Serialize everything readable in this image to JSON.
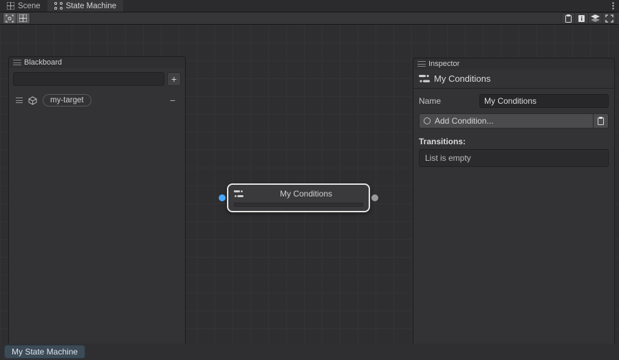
{
  "tabs": {
    "scene": "Scene",
    "state_machine": "State Machine",
    "active": 1
  },
  "blackboard": {
    "title": "Blackboard",
    "items": [
      {
        "label": "my-target"
      }
    ]
  },
  "canvas": {
    "node": {
      "title": "My Conditions"
    }
  },
  "inspector": {
    "title": "Inspector",
    "heading": "My Conditions",
    "name_label": "Name",
    "name_value": "My Conditions",
    "add_condition": "Add Condition...",
    "transitions_label": "Transitions:",
    "transitions_empty": "List is empty"
  },
  "footer": {
    "chip": "My State Machine"
  }
}
